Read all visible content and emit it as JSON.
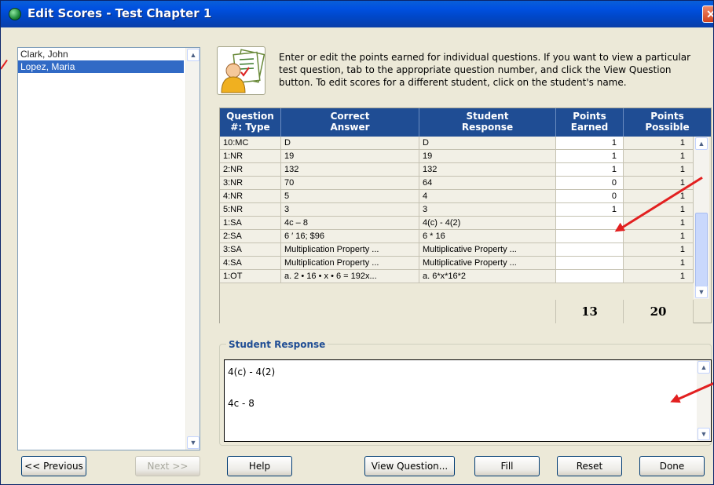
{
  "window": {
    "title": "Edit Scores - Test Chapter 1",
    "close_glyph": "✕"
  },
  "students": [
    {
      "name": "Clark, John",
      "selected": false
    },
    {
      "name": "Lopez, Maria",
      "selected": true
    }
  ],
  "instructions": "Enter or edit the points earned for individual questions.  If you want to view a particular test question, tab to the appropriate question number, and click the View Question button. To edit scores for a different student, click on the student's name.",
  "table": {
    "headers": {
      "q_line1": "Question",
      "q_line2": "#: Type",
      "c_line1": "Correct",
      "c_line2": "Answer",
      "s_line1": "Student",
      "s_line2": "Response",
      "pe_line1": "Points",
      "pe_line2": "Earned",
      "pp_line1": "Points",
      "pp_line2": "Possible"
    },
    "rows": [
      {
        "q": "10:MC",
        "correct": "D",
        "student": "D",
        "earned": "1",
        "possible": "1"
      },
      {
        "q": "1:NR",
        "correct": "19",
        "student": "19",
        "earned": "1",
        "possible": "1"
      },
      {
        "q": "2:NR",
        "correct": "132",
        "student": "132",
        "earned": "1",
        "possible": "1"
      },
      {
        "q": "3:NR",
        "correct": "70",
        "student": "64",
        "earned": "0",
        "possible": "1"
      },
      {
        "q": "4:NR",
        "correct": "5",
        "student": "4",
        "earned": "0",
        "possible": "1"
      },
      {
        "q": "5:NR",
        "correct": "3",
        "student": "3",
        "earned": "1",
        "possible": "1"
      },
      {
        "q": "1:SA",
        "correct": "4c – 8",
        "student": "4(c) - 4(2)",
        "earned": "",
        "possible": "1"
      },
      {
        "q": "2:SA",
        "correct": "6 ′ 16; $96",
        "student": "6 * 16",
        "earned": "",
        "possible": "1"
      },
      {
        "q": "3:SA",
        "correct": "Multiplication Property ...",
        "student": "Multiplicative Property ...",
        "earned": "",
        "possible": "1"
      },
      {
        "q": "4:SA",
        "correct": "Multiplication Property ...",
        "student": "Multiplicative Property ...",
        "earned": "",
        "possible": "1"
      },
      {
        "q": "1:OT",
        "correct": "a.  2 • 16 • x • 6 = 192x...",
        "student": "a. 6*x*16*2",
        "earned": "",
        "possible": "1"
      }
    ],
    "total_earned": "13",
    "total_possible": "20"
  },
  "student_response": {
    "label": "Student Response",
    "line1": "4(c) - 4(2)",
    "line2": "4c - 8"
  },
  "buttons": {
    "previous": "<< Previous",
    "next": "Next >>",
    "help": "Help",
    "view_question": "View Question...",
    "fill": "Fill",
    "reset": "Reset",
    "done": "Done"
  },
  "colors": {
    "title_bar": "#0054e3",
    "header_bg": "#1f4d94",
    "selection": "#316ac5",
    "annotation_arrow": "#e22020"
  }
}
